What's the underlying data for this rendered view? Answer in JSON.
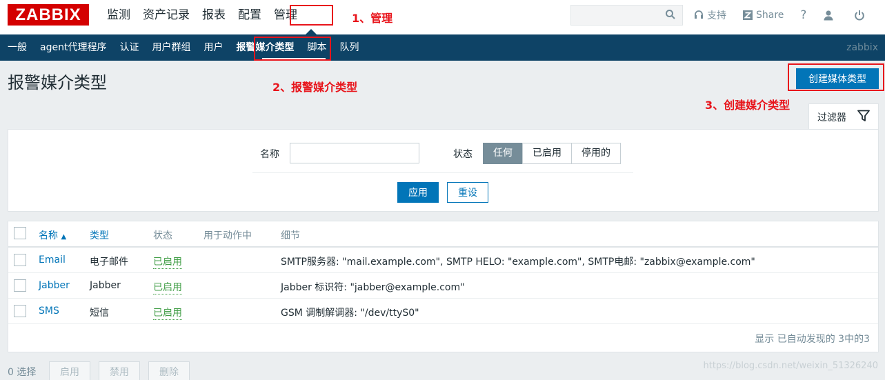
{
  "logo": "ZABBIX",
  "top_menu": [
    "监测",
    "资产记录",
    "报表",
    "配置",
    "管理"
  ],
  "top_right": {
    "support": "支持",
    "share": "Share",
    "help": "?"
  },
  "sub_menu": [
    "一般",
    "agent代理程序",
    "认证",
    "用户群组",
    "用户",
    "报警媒介类型",
    "脚本",
    "队列"
  ],
  "sub_user": "zabbix",
  "annotations": {
    "a1": "1、管理",
    "a2": "2、报警媒介类型",
    "a3": "3、创建媒介类型"
  },
  "page_title": "报警媒介类型",
  "create_button": "创建媒体类型",
  "filter": {
    "tab_label": "过滤器",
    "name_label": "名称",
    "name_value": "",
    "state_label": "状态",
    "state_options": [
      "任何",
      "已启用",
      "停用的"
    ],
    "apply": "应用",
    "reset": "重设"
  },
  "table": {
    "headers": {
      "name": "名称",
      "type": "类型",
      "status": "状态",
      "used": "用于动作中",
      "details": "细节"
    },
    "rows": [
      {
        "name": "Email",
        "type": "电子邮件",
        "status": "已启用",
        "used": "",
        "details": "SMTP服务器: \"mail.example.com\", SMTP HELO: \"example.com\", SMTP电邮: \"zabbix@example.com\""
      },
      {
        "name": "Jabber",
        "type": "Jabber",
        "status": "已启用",
        "used": "",
        "details": "Jabber 标识符: \"jabber@example.com\""
      },
      {
        "name": "SMS",
        "type": "短信",
        "status": "已启用",
        "used": "",
        "details": "GSM 调制解调器: \"/dev/ttyS0\""
      }
    ],
    "footer": "显示 已自动发现的 3中的3"
  },
  "bottom": {
    "selected": "0 选择",
    "enable": "启用",
    "disable": "禁用",
    "delete": "删除"
  },
  "watermark": "https://blog.csdn.net/weixin_51326240"
}
